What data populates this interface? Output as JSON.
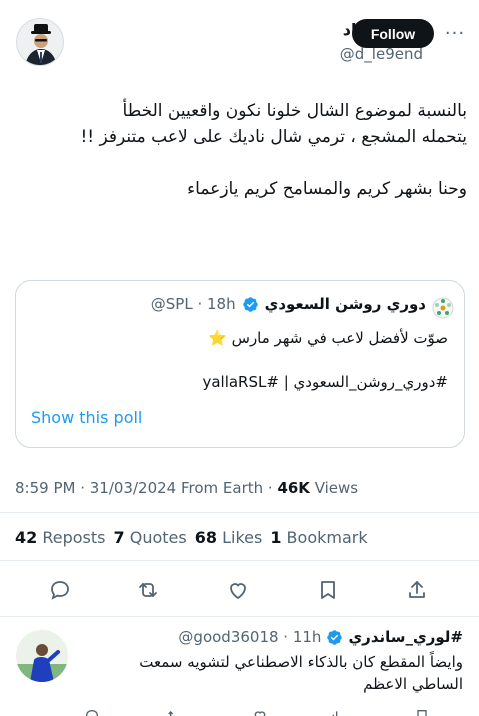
{
  "tweet": {
    "author_name": "د.الحماد",
    "author_handle": "@d_le9end",
    "follow_label": "Follow",
    "more_label": "···",
    "body_line1": "بالنسبة لموضوع الشال خلونا نكون واقعيين الخطأ",
    "body_line2": "يتحمله المشجع ، ترمي شال ناديك على لاعب متنرفز !!",
    "body_line3": "وحنا بشهر كريم والمسامح كريم يازعماء"
  },
  "quote": {
    "name": "دوري روشن السعودي",
    "handle": "@SPL · 18h",
    "line1": "صوّت لأفضل لاعب في شهر مارس ⭐",
    "line2": "#دوري_روشن_السعودي | #yallaRSL",
    "show_poll": "Show this poll"
  },
  "meta": {
    "time": "8:59 PM · 31/03/2024 From Earth · ",
    "views_count": "46K",
    "views_label": " Views"
  },
  "stats": {
    "reposts_count": "42",
    "reposts_label": "Reposts",
    "quotes_count": "7",
    "quotes_label": "Quotes",
    "likes_count": "68",
    "likes_label": "Likes",
    "bookmarks_count": "1",
    "bookmarks_label": "Bookmark"
  },
  "reply": {
    "name": "#لوري_ساندري",
    "handle": "@good36018 · 11h",
    "line1": "وايضاً المقطع كان بالذكاء الاصطناعي لتشويه سمعت",
    "line2": "الساطي الاعظم"
  },
  "icons": {
    "verified_color": "#1d9bf0",
    "action_color": "#536471"
  }
}
